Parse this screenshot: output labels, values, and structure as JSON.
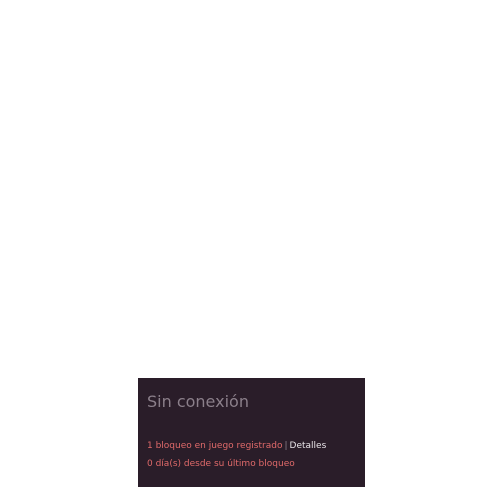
{
  "panel": {
    "status_title": "Sin conexión",
    "crash_count_text": "1 bloqueo en juego registrado",
    "separator": "|",
    "details_link": "Detalles",
    "days_since_text": "0 día(s) desde su último bloqueo"
  },
  "colors": {
    "panel_background": "#2a1d29",
    "title_text": "#8b7f8a",
    "crash_text": "#e06a6a",
    "link_text": "#e8e4e8"
  }
}
